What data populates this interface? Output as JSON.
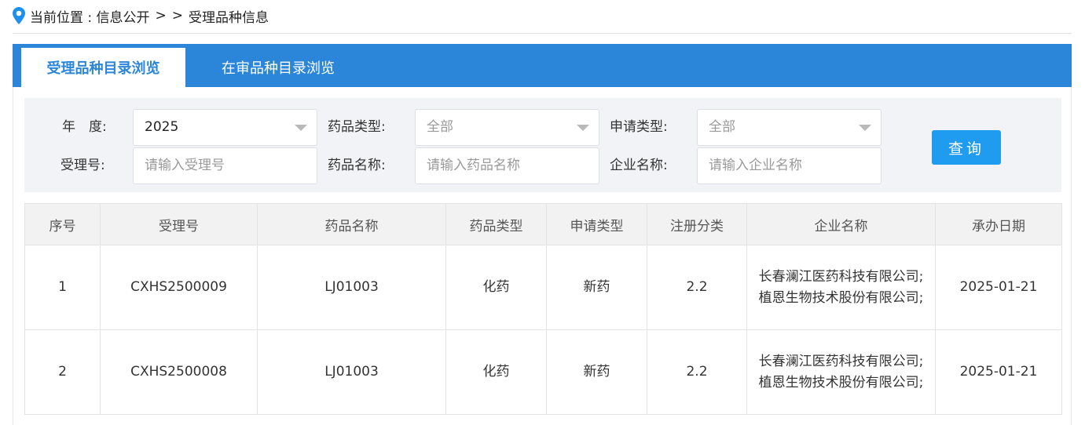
{
  "breadcrumb": {
    "prefix": "当前位置 : 信息公开",
    "sep1": ">",
    "sep2": ">",
    "current": "受理品种信息"
  },
  "tabs": [
    {
      "label": "受理品种目录浏览",
      "active": true
    },
    {
      "label": "在审品种目录浏览",
      "active": false
    }
  ],
  "filters": {
    "year_label": "年　度:",
    "year_value": "2025",
    "drug_type_label": "药品类型:",
    "drug_type_value": "全部",
    "apply_type_label": "申请类型:",
    "apply_type_value": "全部",
    "accept_no_label": "受理号:",
    "accept_no_placeholder": "请输入受理号",
    "drug_name_label": "药品名称:",
    "drug_name_placeholder": "请输入药品名称",
    "company_label": "企业名称:",
    "company_placeholder": "请输入企业名称",
    "query_label": "查询"
  },
  "table": {
    "headers": [
      "序号",
      "受理号",
      "药品名称",
      "药品类型",
      "申请类型",
      "注册分类",
      "企业名称",
      "承办日期"
    ],
    "rows": [
      [
        "1",
        "CXHS2500009",
        "LJ01003",
        "化药",
        "新药",
        "2.2",
        "长春澜江医药科技有限公司;植恩生物技术股份有限公司;",
        "2025-01-21"
      ],
      [
        "2",
        "CXHS2500008",
        "LJ01003",
        "化药",
        "新药",
        "2.2",
        "长春澜江医药科技有限公司;植恩生物技术股份有限公司;",
        "2025-01-21"
      ]
    ]
  },
  "colors": {
    "tab_bar": "#2b86d9",
    "button": "#1f9cf0",
    "pin": "#1e8ff0"
  },
  "icons": {
    "location": "location-pin-icon",
    "dropdown": "chevron-down-icon"
  }
}
